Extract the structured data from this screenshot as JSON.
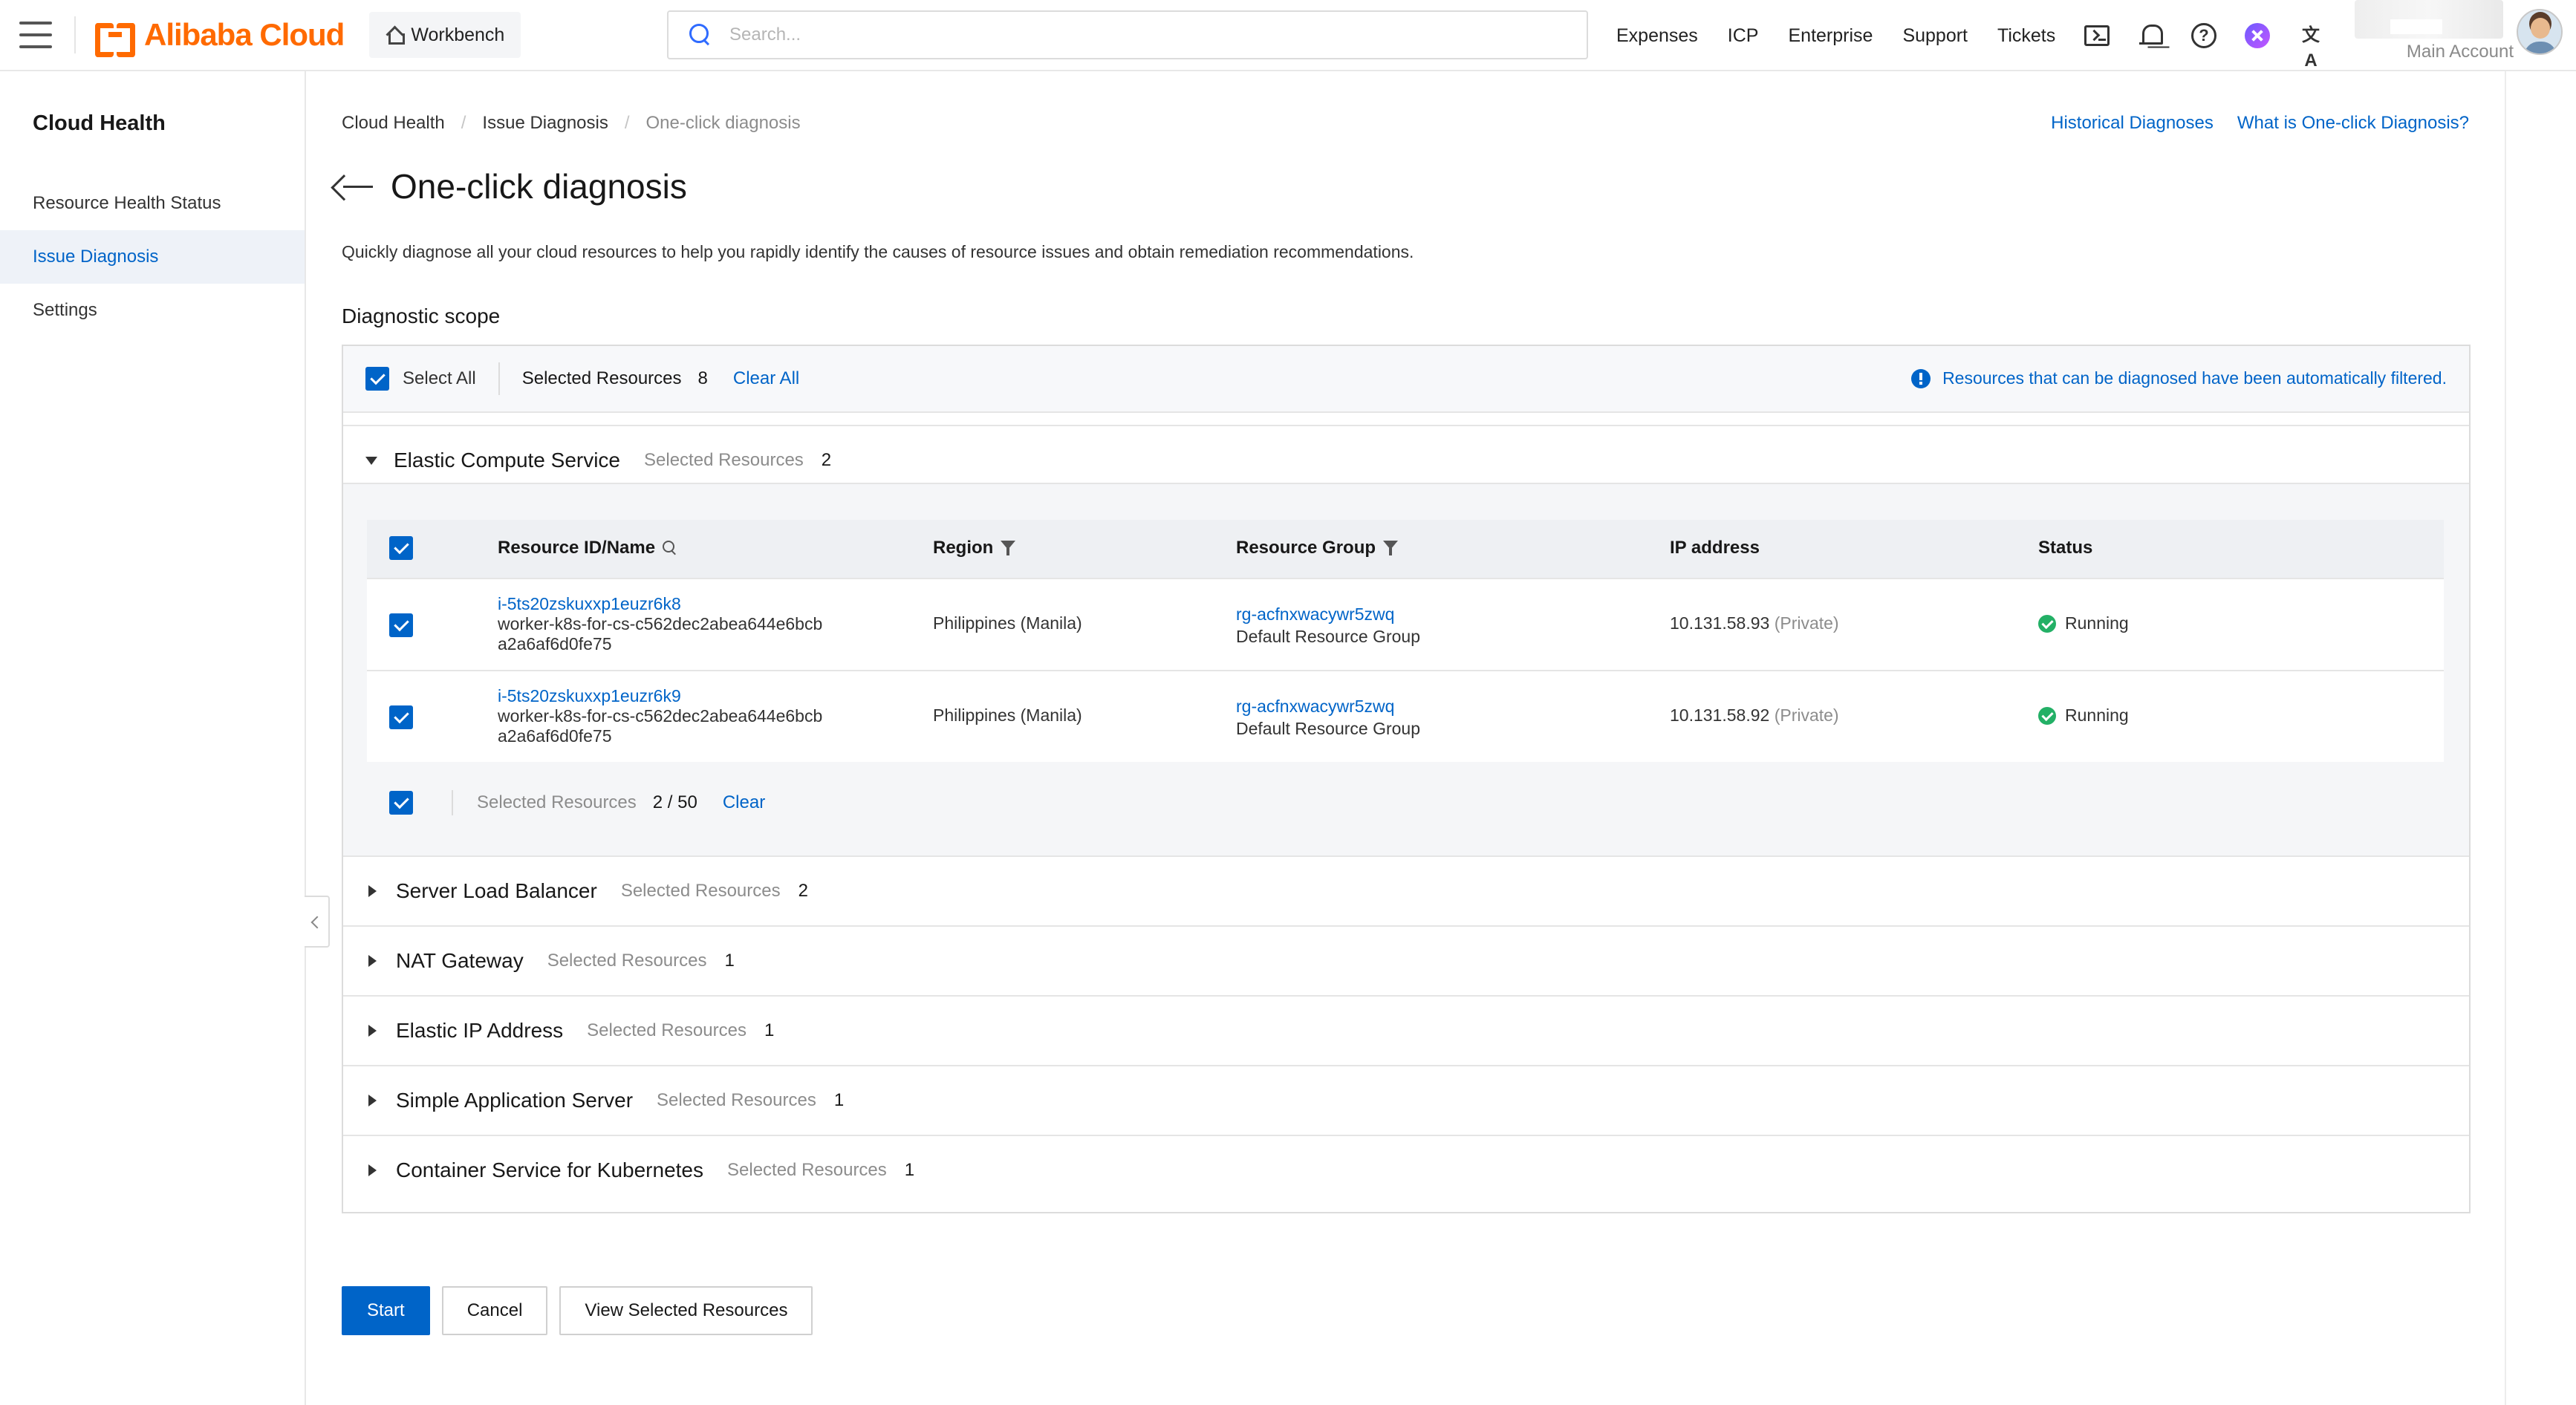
{
  "topbar": {
    "logo_text": "Alibaba Cloud",
    "workbench": "Workbench",
    "search_placeholder": "Search...",
    "nav": [
      "Expenses",
      "ICP",
      "Enterprise",
      "Support",
      "Tickets"
    ],
    "lang_glyph": "文A",
    "help_glyph": "?",
    "account_label": "Main Account",
    "brand_color": "#ff6a00"
  },
  "sidebar": {
    "title": "Cloud Health",
    "items": [
      {
        "label": "Resource Health Status",
        "active": false
      },
      {
        "label": "Issue Diagnosis",
        "active": true
      },
      {
        "label": "Settings",
        "active": false
      }
    ]
  },
  "breadcrumb": [
    "Cloud Health",
    "Issue Diagnosis",
    "One-click diagnosis"
  ],
  "breadcrumb_sep": "/",
  "top_links": [
    "Historical Diagnoses",
    "What is One-click Diagnosis?"
  ],
  "page": {
    "title": "One-click diagnosis",
    "subtitle": "Quickly diagnose all your cloud resources to help you rapidly identify the causes of resource issues and obtain remediation recommendations.",
    "section_title": "Diagnostic scope",
    "accent_color": "#0064c8"
  },
  "select_bar": {
    "select_all": "Select All",
    "selected_label": "Selected Resources",
    "selected_count": "8",
    "clear_all": "Clear All",
    "note": "Resources that can be diagnosed have been automatically filtered."
  },
  "services": [
    {
      "name": "Elastic Compute Service",
      "selected_label": "Selected Resources",
      "count": "2",
      "expanded": true
    },
    {
      "name": "Server Load Balancer",
      "selected_label": "Selected Resources",
      "count": "2",
      "expanded": false
    },
    {
      "name": "NAT Gateway",
      "selected_label": "Selected Resources",
      "count": "1",
      "expanded": false
    },
    {
      "name": "Elastic IP Address",
      "selected_label": "Selected Resources",
      "count": "1",
      "expanded": false
    },
    {
      "name": "Simple Application Server",
      "selected_label": "Selected Resources",
      "count": "1",
      "expanded": false
    },
    {
      "name": "Container Service for Kubernetes",
      "selected_label": "Selected Resources",
      "count": "1",
      "expanded": false
    }
  ],
  "resource_table": {
    "headers": {
      "id": "Resource ID/Name",
      "region": "Region",
      "group": "Resource Group",
      "ip": "IP address",
      "status": "Status"
    },
    "rows": [
      {
        "id": "i-5ts20zskuxxp1euzr6k8",
        "name_line1": "worker-k8s-for-cs-c562dec2abea644e6bcb",
        "name_line2": "a2a6af6d0fe75",
        "region": "Philippines (Manila)",
        "group_id": "rg-acfnxwacywr5zwq",
        "group_name": "Default Resource Group",
        "ip": "10.131.58.93",
        "ip_type": "(Private)",
        "status": "Running"
      },
      {
        "id": "i-5ts20zskuxxp1euzr6k9",
        "name_line1": "worker-k8s-for-cs-c562dec2abea644e6bcb",
        "name_line2": "a2a6af6d0fe75",
        "region": "Philippines (Manila)",
        "group_id": "rg-acfnxwacywr5zwq",
        "group_name": "Default Resource Group",
        "ip": "10.131.58.92",
        "ip_type": "(Private)",
        "status": "Running"
      }
    ],
    "footer": {
      "selected_label": "Selected Resources",
      "count": "2 / 50",
      "clear": "Clear"
    }
  },
  "actions": {
    "start": "Start",
    "cancel": "Cancel",
    "view_selected": "View Selected Resources"
  }
}
